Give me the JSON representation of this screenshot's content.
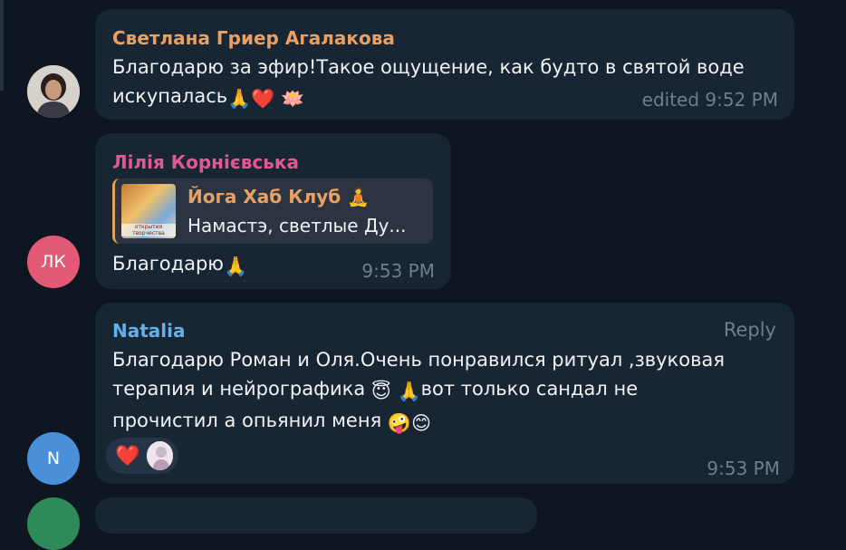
{
  "messages": [
    {
      "sender": "Светлана Гриер Агалакова",
      "sender_color": "#e8a163",
      "text_line1": "Благодарю за эфир!Такое ощущение, как будто в святой воде",
      "text_line2": "искупалась",
      "emojis": [
        "🙏",
        "❤️",
        "🪷"
      ],
      "edited_time": "edited 9:52 PM"
    },
    {
      "sender": "Лілія Корнієвська",
      "sender_color": "#e05a8f",
      "avatar_initials": "ЛК",
      "avatar_color": "#e35a77",
      "quote": {
        "title": "Йога Хаб Клуб",
        "title_emoji": "🧘",
        "preview": "Намастэ, светлые Ду...",
        "thumb_caption": "открытия творчества"
      },
      "text": "Благодарю",
      "emojis": [
        "🙏"
      ],
      "time": "9:53 PM"
    },
    {
      "sender": "Natalia",
      "sender_color": "#64b0e8",
      "avatar_initials": "N",
      "avatar_color": "#4a90d9",
      "reply_label": "Reply",
      "text_line1": "Благодарю Роман и Оля.Очень понравился ритуал ,звуковая",
      "text_line2a": "терапия и нейрографика",
      "text_line2_emojis": [
        "😇",
        "🙏"
      ],
      "text_line2b": "вот только сандал не",
      "text_line3": "прочистил а опьянил меня",
      "text_line3_emojis": [
        "🤪",
        "😊"
      ],
      "reaction_emoji": "❤️",
      "time": "9:53 PM"
    }
  ]
}
